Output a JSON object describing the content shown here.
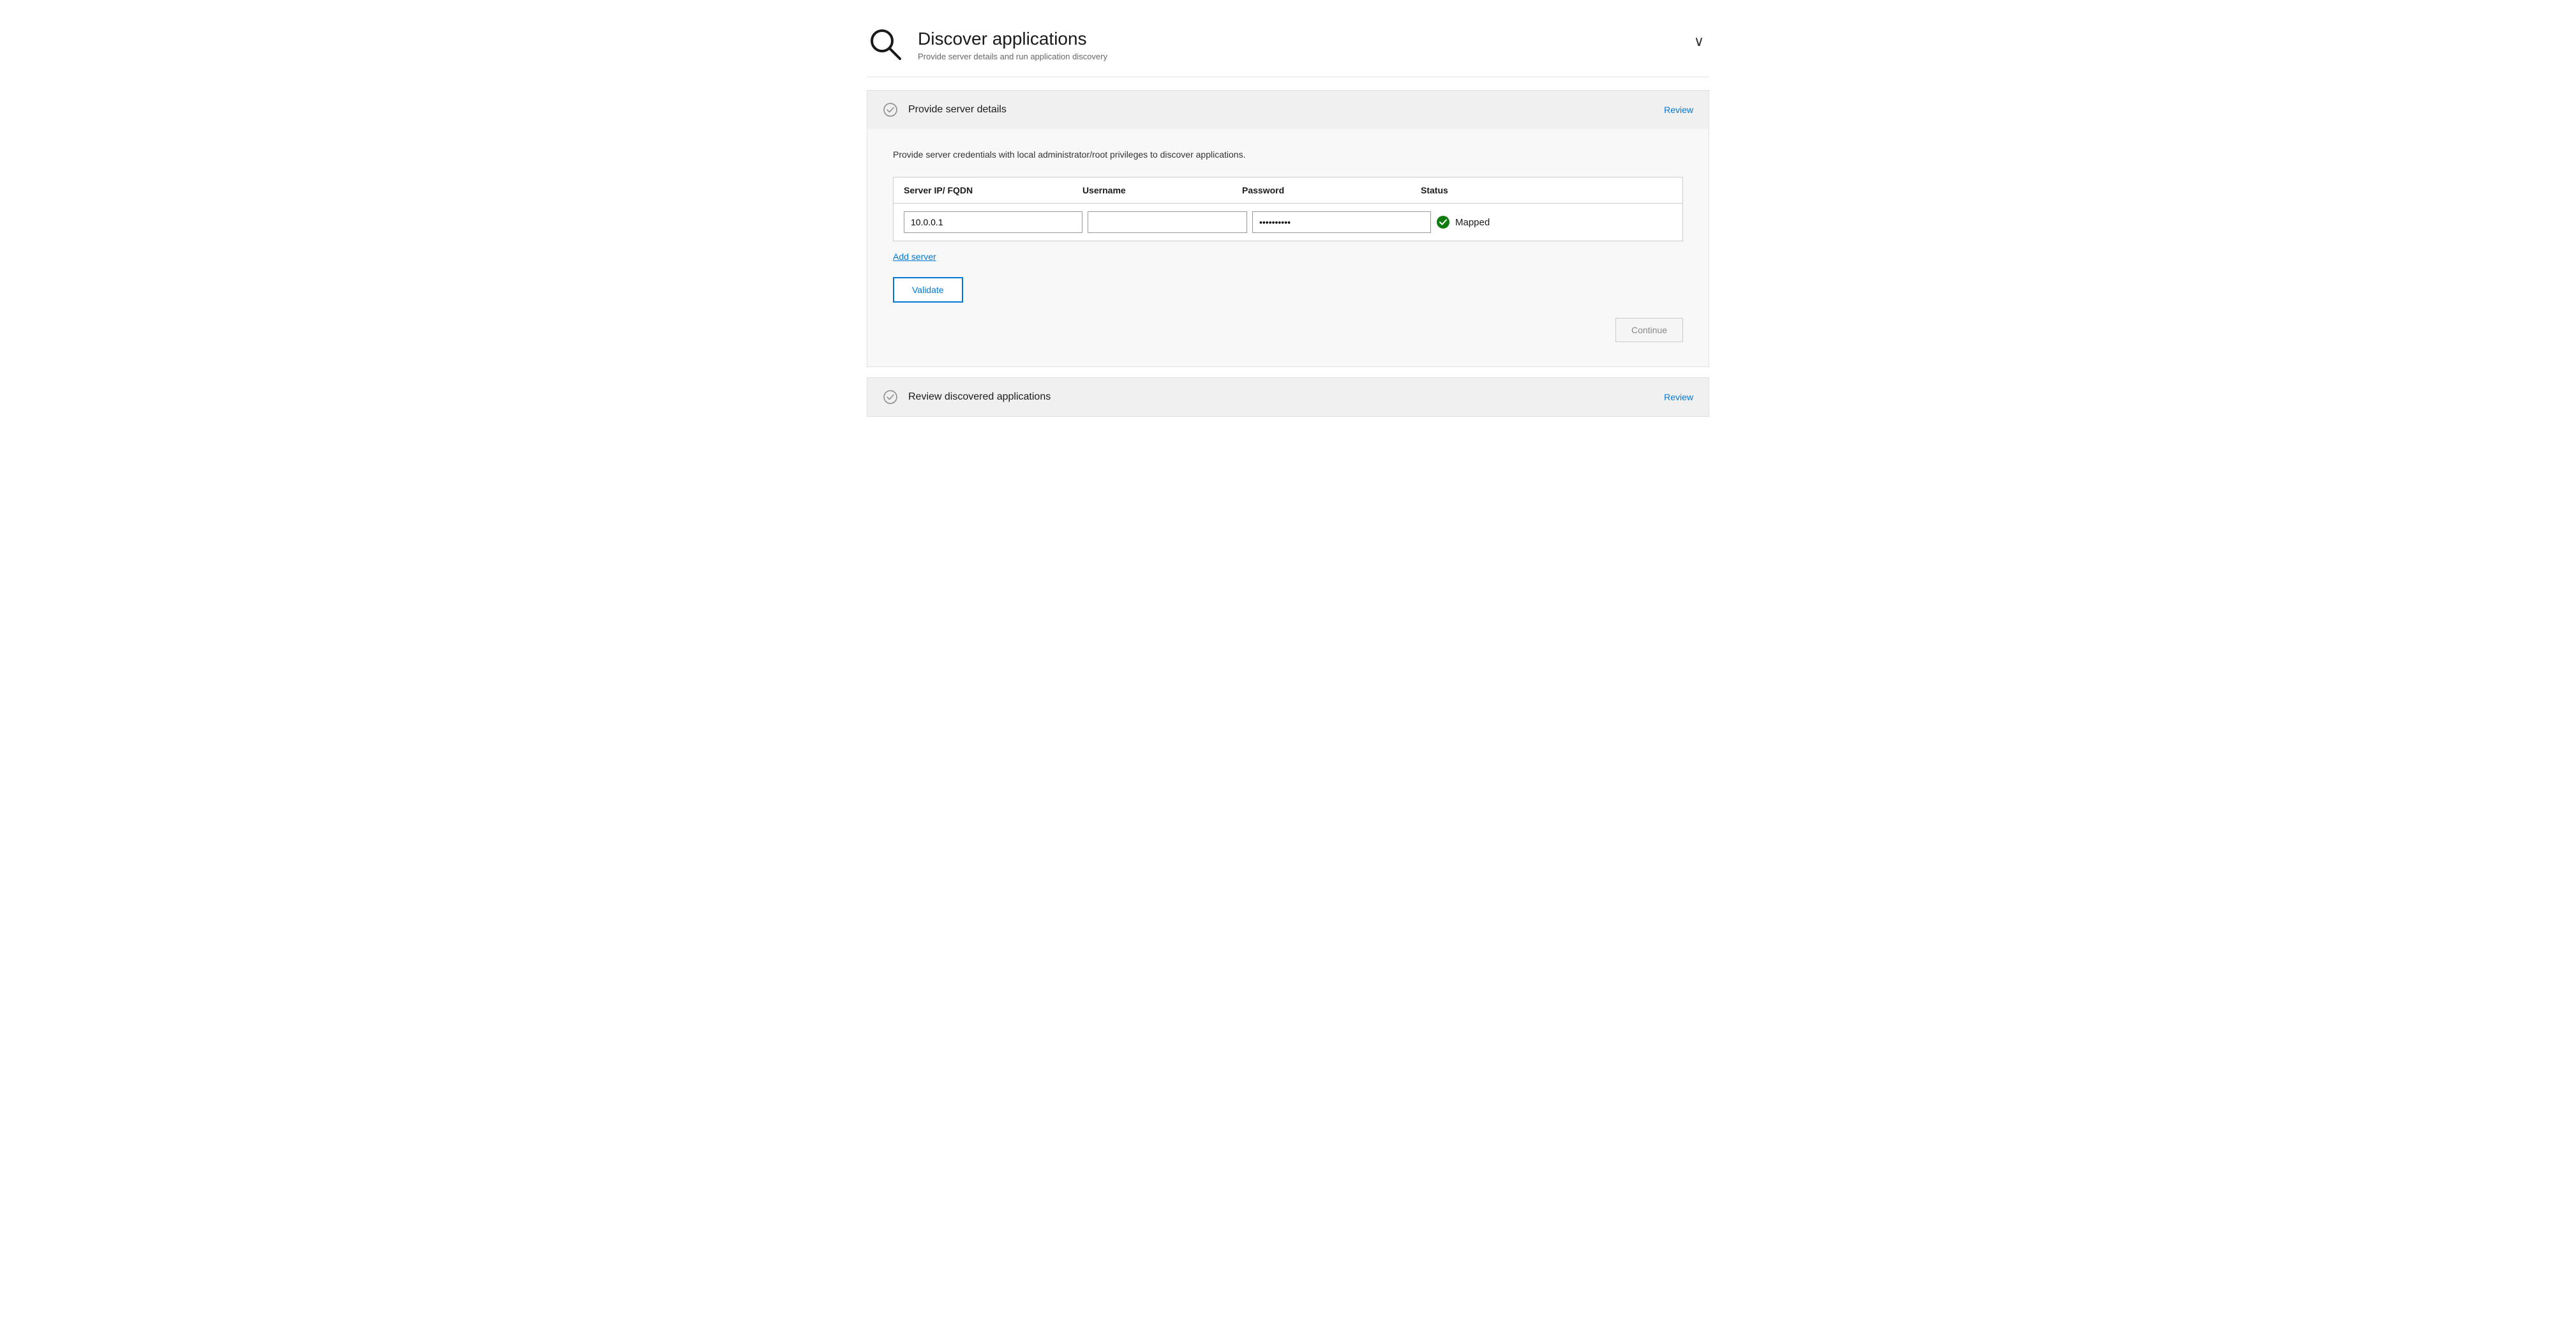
{
  "header": {
    "title": "Discover applications",
    "subtitle": "Provide server details and run application discovery",
    "collapse_label": "∨"
  },
  "sections": [
    {
      "id": "provide-server-details",
      "title": "Provide server details",
      "review_label": "Review",
      "completed": true,
      "description": "Provide server credentials with local administrator/root privileges to discover applications.",
      "table": {
        "columns": [
          "Server IP/ FQDN",
          "Username",
          "Password",
          "Status"
        ],
        "rows": [
          {
            "server_ip": "10.0.0.1",
            "username": "",
            "password": "••••••••••",
            "status": "Mapped"
          }
        ]
      },
      "add_server_label": "Add server",
      "validate_label": "Validate",
      "continue_label": "Continue"
    },
    {
      "id": "review-discovered-applications",
      "title": "Review discovered applications",
      "review_label": "Review",
      "completed": true
    }
  ]
}
